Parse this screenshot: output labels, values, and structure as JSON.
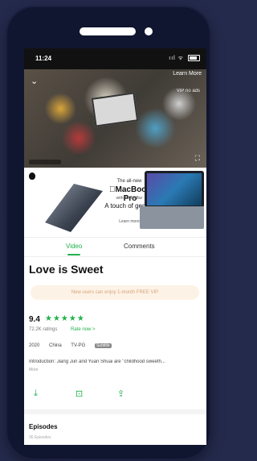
{
  "status": {
    "time": "11:24",
    "signal": "ııl ᯤ"
  },
  "video": {
    "learn_more": "Learn More",
    "vip_ads": "VIP no ads"
  },
  "ad": {
    "all_new": "The all-new",
    "brand": "MacBook Pro",
    "sub": "with Touch Bar",
    "tagline": "A touch of genius",
    "cta": "Learn more"
  },
  "tabs": {
    "video": "Video",
    "comments": "Comments"
  },
  "show": {
    "title": "Love is Sweet",
    "vip_banner": "New users can enjoy 1-month FREE VIP",
    "score": "9.4",
    "stars": "★★★★★",
    "ratings": "72.2K ratings",
    "rate_now": "Rate now >",
    "year": "2020",
    "region": "China",
    "rating": "TV-PG",
    "badge": "Subtitle",
    "intro": "Introduction: Jiang Jun and Yuan Shuai are \"childhood sweeth...",
    "more": "More"
  },
  "episodes": {
    "title": "Episodes",
    "count": "36 Episodes"
  },
  "colors": {
    "accent": "#22b04b",
    "vip_text": "#d7a57a",
    "frame": "#10162f"
  },
  "icons": [
    "download-icon",
    "bookmark-icon",
    "share-icon",
    "fullscreen-icon",
    "chevron-down-icon"
  ]
}
